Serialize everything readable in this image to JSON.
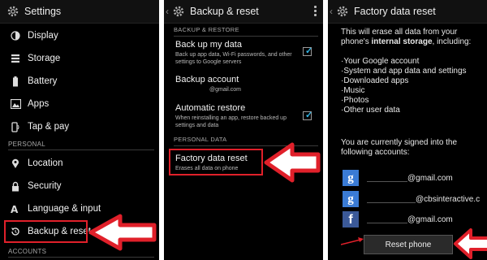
{
  "panel1": {
    "title": "Settings",
    "items": [
      {
        "label": "Display",
        "icon": "display-icon"
      },
      {
        "label": "Storage",
        "icon": "storage-icon"
      },
      {
        "label": "Battery",
        "icon": "battery-icon"
      },
      {
        "label": "Apps",
        "icon": "apps-icon"
      },
      {
        "label": "Tap & pay",
        "icon": "tap-pay-icon"
      },
      {
        "label": "Location",
        "icon": "location-icon"
      },
      {
        "label": "Security",
        "icon": "security-icon"
      },
      {
        "label": "Language & input",
        "icon": "language-icon"
      },
      {
        "label": "Backup & reset",
        "icon": "backup-reset-icon"
      }
    ],
    "section_personal": "PERSONAL",
    "section_accounts": "ACCOUNTS"
  },
  "panel2": {
    "title": "Backup & reset",
    "section_backup": "BACKUP & RESTORE",
    "backup_data_title": "Back up my data",
    "backup_data_desc": "Back up app data, Wi-Fi passwords, and other settings to Google servers",
    "backup_account_title": "Backup account",
    "backup_account_value": "@gmail.com",
    "auto_restore_title": "Automatic restore",
    "auto_restore_desc": "When reinstalling an app, restore backed up settings and data",
    "section_personal": "PERSONAL DATA",
    "factory_title": "Factory data reset",
    "factory_desc": "Erases all data on phone",
    "backup_data_checked": true,
    "auto_restore_checked": true
  },
  "panel3": {
    "title": "Factory data reset",
    "intro_1": "This will erase all data from your",
    "intro_2_prefix": "phone's ",
    "intro_2_bold": "internal storage",
    "intro_2_suffix": ", including:",
    "list": [
      "Your Google account",
      "System and app data and settings",
      "Downloaded apps",
      "Music",
      "Photos",
      "Other user data"
    ],
    "signed_in_1": "You are currently signed into the",
    "signed_in_2": "following accounts:",
    "accounts": [
      {
        "email": "@gmail.com",
        "icon": "google-icon"
      },
      {
        "email": "@cbsinteractive.c",
        "icon": "google-icon"
      },
      {
        "email": "@gmail.com",
        "icon": "facebook-icon"
      }
    ],
    "reset_button": "Reset phone"
  },
  "colors": {
    "highlight": "#e0202a",
    "accent": "#33b5e5"
  }
}
